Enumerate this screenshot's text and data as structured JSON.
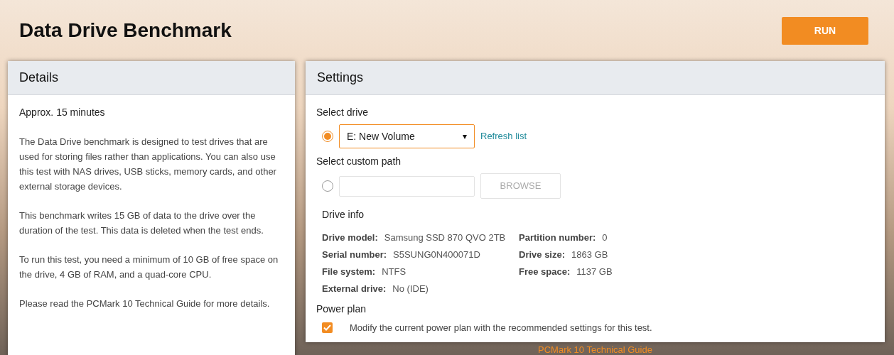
{
  "title": "Data Drive Benchmark",
  "run_button": "RUN",
  "details": {
    "heading": "Details",
    "duration": "Approx. 15 minutes",
    "paragraphs": [
      "The Data Drive benchmark is designed to test drives that are used for storing files rather than applications. You can also use this test with NAS drives, USB sticks, memory cards, and other external storage devices.",
      "This benchmark writes 15 GB of data to the drive over the duration of the test. This data is deleted when the test ends.",
      "To run this test, you need a minimum of 10 GB of free space on the drive, 4 GB of RAM, and a quad-core CPU.",
      "Please read the PCMark 10 Technical Guide for more details."
    ]
  },
  "settings": {
    "heading": "Settings",
    "select_drive": {
      "label": "Select drive",
      "selected": true,
      "value": "E: New Volume",
      "caret": "▾",
      "refresh_link": "Refresh list"
    },
    "custom_path": {
      "label": "Select custom path",
      "selected": false,
      "browse_button": "BROWSE",
      "disabled": true
    },
    "drive_info": {
      "heading": "Drive info",
      "left": [
        {
          "label": "Drive model:",
          "value": "Samsung SSD 870 QVO 2TB"
        },
        {
          "label": "Serial number:",
          "value": "S5SUNG0N400071D"
        },
        {
          "label": "File system:",
          "value": "NTFS"
        },
        {
          "label": "External drive:",
          "value": "No (IDE)"
        }
      ],
      "right": [
        {
          "label": "Partition number:",
          "value": "0"
        },
        {
          "label": "Drive size:",
          "value": "1863 GB"
        },
        {
          "label": "Free space:",
          "value": "1137 GB"
        }
      ]
    },
    "power_plan": {
      "heading": "Power plan",
      "checked": true,
      "text": "Modify the current power plan with the recommended settings for this test."
    }
  },
  "footer_link": "PCMark 10 Technical Guide"
}
